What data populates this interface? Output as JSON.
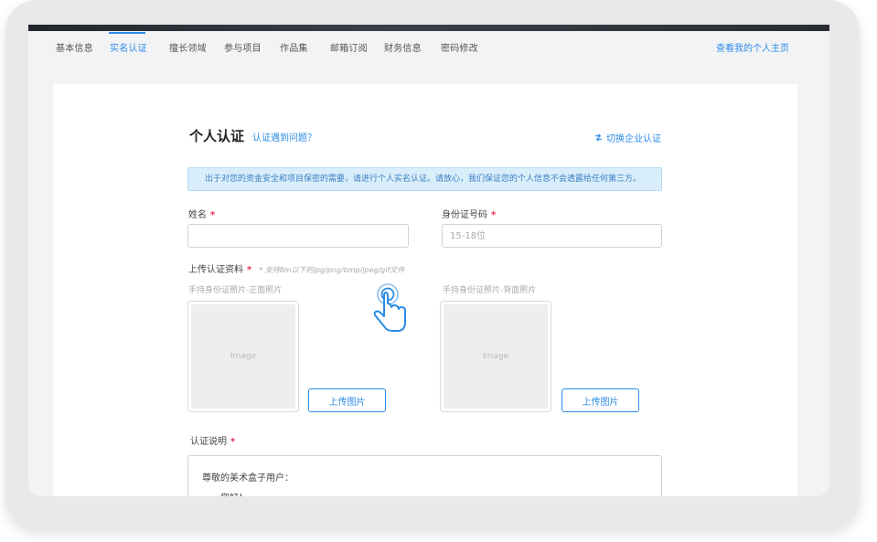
{
  "tabs": [
    {
      "label": "基本信息",
      "active": false
    },
    {
      "label": "实名认证",
      "active": true
    },
    {
      "label": "擅长领域",
      "active": false
    },
    {
      "label": "参与项目",
      "active": false
    },
    {
      "label": "作品集",
      "active": false
    },
    {
      "label": "邮箱订阅",
      "active": false
    },
    {
      "label": "财务信息",
      "active": false
    },
    {
      "label": "密码修改",
      "active": false
    }
  ],
  "profile_link": "查看我的个人主页",
  "form": {
    "title": "个人认证",
    "help_link": "认证遇到问题？",
    "switch_link": "切换企业认证",
    "notice": "出于对您的资金安全和项目保密的需要，请进行个人实名认证。请放心，我们保证您的个人信息不会透露给任何第三方。",
    "name_label": "姓名",
    "name_value": "",
    "name_placeholder": "",
    "id_label": "身份证号码",
    "id_value": "",
    "id_placeholder": "15-18位",
    "required_mark": "*",
    "upload_label": "上传认证资料",
    "upload_hint": "* 支持8m以下的jpg/png/bmp/jpeg/gif文件",
    "front_label": "手持身份证照片-正面照片",
    "back_label": "手持身份证照片-背面照片",
    "image_placeholder": "Image",
    "upload_button": "上传图片",
    "desc_label": "认证说明",
    "desc_greeting": "尊敬的美术盒子用户：",
    "desc_line2": "您好！"
  },
  "colors": {
    "accent": "#2b8be6",
    "required": "#e5304f",
    "notice_bg": "#d9eefb"
  },
  "icons": {
    "switch": "swap-icon",
    "cursor": "hand-pointer-icon"
  }
}
